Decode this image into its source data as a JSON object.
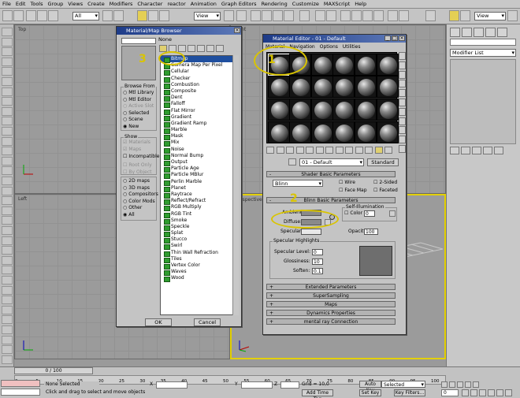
{
  "menu": [
    "File",
    "Edit",
    "Tools",
    "Group",
    "Views",
    "Create",
    "Modifiers",
    "Character",
    "reactor",
    "Animation",
    "Graph Editors",
    "Rendering",
    "Customize",
    "MAXScript",
    "Help"
  ],
  "toolbar": {
    "selection_filter": "All",
    "ref_coord": "View",
    "ref_coord2": "View"
  },
  "command_panel": {
    "modifier_list": "Modifier List"
  },
  "viewports": [
    "Top",
    "Front",
    "Left",
    "Perspective"
  ],
  "browser": {
    "title": "Material/Map Browser",
    "name_field": "None",
    "browse_from_title": "Browse From",
    "browse_from": [
      {
        "label": "Mtl Library",
        "on": false,
        "dim": false
      },
      {
        "label": "Mtl Editor",
        "on": false,
        "dim": false
      },
      {
        "label": "Active Slot",
        "on": false,
        "dim": true
      },
      {
        "label": "Selected",
        "on": false,
        "dim": false
      },
      {
        "label": "Scene",
        "on": false,
        "dim": false
      },
      {
        "label": "New",
        "on": true,
        "dim": false
      }
    ],
    "show_title": "Show",
    "show": [
      {
        "label": "Materials",
        "on": true,
        "dim": true
      },
      {
        "label": "Maps",
        "on": true,
        "dim": true
      },
      {
        "label": "Incompatible",
        "on": false,
        "dim": false
      },
      {
        "label": "Root Only",
        "on": false,
        "dim": true
      },
      {
        "label": "By Object",
        "on": false,
        "dim": true
      }
    ],
    "map_types": [
      {
        "label": "2D maps",
        "on": false
      },
      {
        "label": "3D maps",
        "on": false
      },
      {
        "label": "Compositors",
        "on": false
      },
      {
        "label": "Color Mods",
        "on": false
      },
      {
        "label": "Other",
        "on": false
      },
      {
        "label": "All",
        "on": true
      }
    ],
    "items": [
      "Bitmap",
      "Camera Map Per Pixel",
      "Cellular",
      "Checker",
      "Combustion",
      "Composite",
      "Dent",
      "Falloff",
      "Flat Mirror",
      "Gradient",
      "Gradient Ramp",
      "Marble",
      "Mask",
      "Mix",
      "Noise",
      "Normal Bump",
      "Output",
      "Particle Age",
      "Particle MBlur",
      "Perlin Marble",
      "Planet",
      "Raytrace",
      "Reflect/Refract",
      "RGB Multiply",
      "RGB Tint",
      "Smoke",
      "Speckle",
      "Splat",
      "Stucco",
      "Swirl",
      "Thin Wall Refraction",
      "Tiles",
      "Vertex Color",
      "Waves",
      "Wood"
    ],
    "ok_label": "OK",
    "cancel_label": "Cancel"
  },
  "editor": {
    "title": "Material Editor - 01 - Default",
    "menus": [
      "Material",
      "Navigation",
      "Options",
      "Utilities"
    ],
    "material_name": "01 - Default",
    "material_type": "Standard",
    "shader_rollout": "Shader Basic Parameters",
    "shader_type": "Blinn",
    "shader_options": [
      {
        "label": "Wire",
        "on": false
      },
      {
        "label": "2-Sided",
        "on": false
      },
      {
        "label": "Face Map",
        "on": false
      },
      {
        "label": "Faceted",
        "on": false
      }
    ],
    "blinn_rollout": "Blinn Basic Parameters",
    "self_illum_title": "Self-Illumination",
    "color_label": "Color",
    "color_value": "0",
    "ambient_label": "Ambient:",
    "diffuse_label": "Diffuse:",
    "specular_label": "Specular:",
    "opacity_label": "Opacity:",
    "opacity_value": "100",
    "spec_highlights_title": "Specular Highlights",
    "specular_level_label": "Specular Level:",
    "specular_level_value": "0",
    "glossiness_label": "Glossiness:",
    "glossiness_value": "10",
    "soften_label": "Soften:",
    "soften_value": "0.1",
    "rollouts": [
      "Extended Parameters",
      "SuperSampling",
      "Maps",
      "Dynamics Properties",
      "mental ray Connection"
    ],
    "colors": {
      "ambient": "#8a8a8a",
      "diffuse": "#8a8a8a",
      "specular": "#e8e8e8"
    }
  },
  "annotations": [
    "3",
    "1",
    "2"
  ],
  "status": {
    "time_slider": "0 / 100",
    "selection": "None Selected",
    "prompt": "Click and drag to select and move objects",
    "x_label": "X",
    "y_label": "Y",
    "z_label": "Z",
    "grid": "Grid = 10,0",
    "add_time_tag": "Add Time Tag",
    "auto_key": "Auto Key",
    "set_key": "Set Key",
    "selected": "Selected",
    "key_filters": "Key Filters...",
    "frame": "0",
    "ticks": [
      "0",
      "5",
      "10",
      "15",
      "20",
      "25",
      "30",
      "35",
      "40",
      "45",
      "50",
      "55",
      "60",
      "65",
      "70",
      "75",
      "80",
      "85",
      "90",
      "95",
      "100"
    ]
  }
}
